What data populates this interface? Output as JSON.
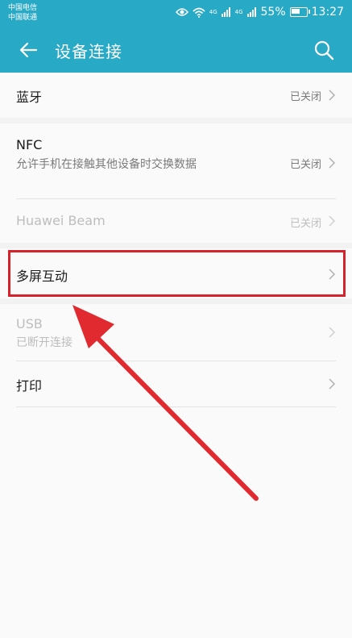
{
  "status_bar": {
    "carrier_1": "中国电信",
    "carrier_2": "中国联通",
    "signal_1": "4G",
    "signal_2": "4G",
    "battery": "55%",
    "battery_level": 0.55,
    "time": "13:27"
  },
  "app_bar": {
    "title": "设备连接"
  },
  "items": {
    "bluetooth": {
      "label": "蓝牙",
      "value": "已关闭"
    },
    "nfc": {
      "label": "NFC",
      "subtitle": "允许手机在接触其他设备时交换数据",
      "value": "已关闭"
    },
    "huawei_beam": {
      "label": "Huawei Beam",
      "value": "已关闭"
    },
    "multiscreen": {
      "label": "多屏互动"
    },
    "usb": {
      "label": "USB",
      "subtitle": "已断开连接"
    },
    "print": {
      "label": "打印"
    }
  },
  "colors": {
    "accent": "#28a9c6",
    "highlight": "#d6222b",
    "background": "#f2f2f2",
    "card": "#fafafa"
  }
}
